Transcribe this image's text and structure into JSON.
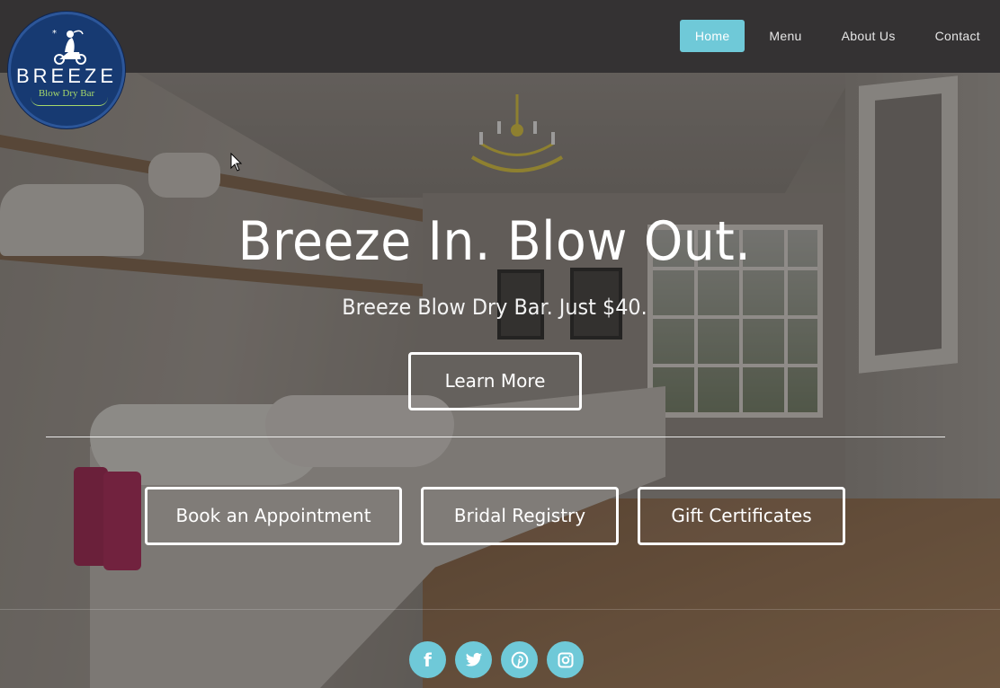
{
  "brand": {
    "name": "BREEZE",
    "tagline": "Blow Dry Bar"
  },
  "nav": {
    "items": [
      {
        "label": "Home",
        "active": true
      },
      {
        "label": "Menu",
        "active": false
      },
      {
        "label": "About Us",
        "active": false
      },
      {
        "label": "Contact",
        "active": false
      }
    ]
  },
  "hero": {
    "headline": "Breeze In. Blow Out.",
    "subhead": "Breeze Blow Dry Bar. Just $40.",
    "cta_label": "Learn More"
  },
  "actions": {
    "book_label": "Book an Appointment",
    "bridal_label": "Bridal Registry",
    "gift_label": "Gift Certificates"
  },
  "social": {
    "facebook": "f",
    "twitter": "twitter-icon",
    "pinterest": "pinterest-icon",
    "instagram": "instagram-icon"
  },
  "colors": {
    "accent": "#6fc9d8",
    "topbar": "#343233",
    "logo_bg": "#173a72",
    "logo_subtext": "#a6d86a"
  }
}
